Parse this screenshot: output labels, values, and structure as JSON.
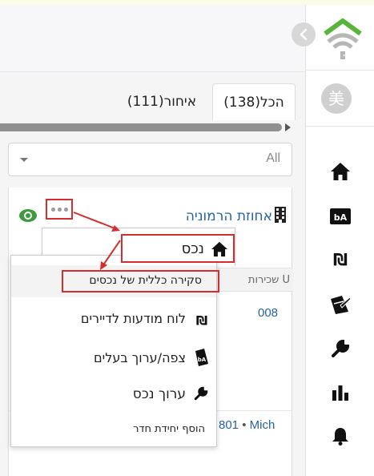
{
  "sidebar": {
    "avatar_text": "美",
    "items": [
      {
        "name": "home-icon"
      },
      {
        "name": "rent-bill-icon"
      },
      {
        "name": "shekel-icon"
      },
      {
        "name": "signature-icon"
      },
      {
        "name": "wrench-icon"
      },
      {
        "name": "bar-chart-icon"
      },
      {
        "name": "bell-icon"
      }
    ]
  },
  "tabs": {
    "all_label": "הכל(138)",
    "late_label": "איחור(111)"
  },
  "filter": {
    "value": "All"
  },
  "property": {
    "title": "אחוזת הרמוניה",
    "column_header": "שכירות U",
    "unit_number": "008",
    "row2_number": "801",
    "row2_separator": " • ",
    "row2_name": "Mich"
  },
  "menu": {
    "header_label": "נכס",
    "items": [
      {
        "label": "סקירה כללית של נכסים"
      },
      {
        "label": "לוח מודעות לדיירים"
      },
      {
        "label": "צפה/ערוך בעלים"
      },
      {
        "label": "ערוך נכס"
      },
      {
        "label": "הוסף יחידת חדר"
      }
    ]
  },
  "colors": {
    "link_blue": "#2563a6",
    "highlight_red": "#d32f2f",
    "eye_green": "#3e9a3e",
    "logo_green": "#57b63a"
  }
}
